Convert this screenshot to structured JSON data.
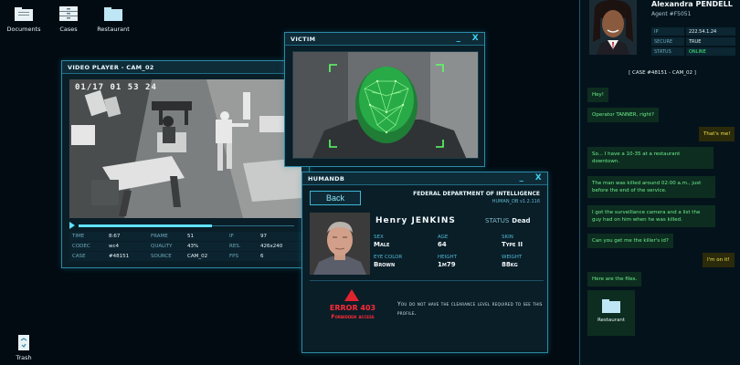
{
  "desktop": {
    "icons": [
      {
        "label": "Documents"
      },
      {
        "label": "Cases"
      },
      {
        "label": "Restaurant"
      },
      {
        "label": "Trash"
      }
    ]
  },
  "video_player": {
    "title": "VIDEO PLAYER - CAM_02",
    "timestamp": "01/17 01 53 24",
    "progress_fraction": 0.62,
    "meta": [
      {
        "k": "TIME",
        "v": "8:67"
      },
      {
        "k": "FRAME",
        "v": "51"
      },
      {
        "k": "IF",
        "v": "97"
      },
      {
        "k": "CODEC",
        "v": "wc4"
      },
      {
        "k": "QUALITY",
        "v": "43%"
      },
      {
        "k": "RES.",
        "v": "426x240"
      },
      {
        "k": "CASE",
        "v": "#48151"
      },
      {
        "k": "SOURCE",
        "v": "CAM_02"
      },
      {
        "k": "FPS",
        "v": "6"
      }
    ]
  },
  "victim": {
    "title": "VICTIM",
    "minimize": "_",
    "close": "X"
  },
  "humandb": {
    "title": "HUMANDB",
    "minimize": "_",
    "close": "X",
    "back_label": "Back",
    "agency": "FEDERAL DEPARTMENT OF INTELLIGENCE",
    "db_version": "HUMAN_DB     v1.2.116",
    "name": "Henry  JENKINS",
    "status_label": "STATUS",
    "status_value": "Dead",
    "fields": [
      {
        "label": "SEX",
        "value": "Male"
      },
      {
        "label": "AGE",
        "value": "64"
      },
      {
        "label": "SKIN",
        "value": "Type II"
      },
      {
        "label": "EYE COLOR",
        "value": "Brown"
      },
      {
        "label": "HEIGHT",
        "value": "1m79"
      },
      {
        "label": "WEIGHT",
        "value": "88kg"
      }
    ],
    "error_code": "ERROR 403",
    "error_sub": "Forbidden access",
    "error_msg": "You do not have the clearance level required to see this profile."
  },
  "agent": {
    "name": "Alexandra PENDELL",
    "id": "Agent #F5051",
    "info": [
      {
        "k": "IP",
        "v": "222.54.1.24"
      },
      {
        "k": "SECURE",
        "v": "TRUE"
      },
      {
        "k": "STATUS",
        "v": "ONLINE"
      }
    ]
  },
  "chat": {
    "case_header": "[ CASE #48151 - CAM_02 ]",
    "messages": [
      {
        "dir": "in",
        "text": "Hey!"
      },
      {
        "dir": "in",
        "text": "Operator TANNER, right?"
      },
      {
        "dir": "out",
        "text": "That's me!"
      },
      {
        "dir": "in",
        "text": "So... I have a 10-35 at a restaurant downtown."
      },
      {
        "dir": "in",
        "text": "The man was killed around 02:00 a.m., just before the end of the service."
      },
      {
        "dir": "in",
        "text": "I got the surveillance camera and a list the guy had on him when he was killed."
      },
      {
        "dir": "in",
        "text": "Can you get me the killer's id?"
      },
      {
        "dir": "out",
        "text": "I'm on it!"
      },
      {
        "dir": "in",
        "text": "Here are the files."
      }
    ],
    "attachment_label": "Restaurant"
  },
  "colors": {
    "accent": "#3fd0ee",
    "error": "#ff2a36",
    "chat_in": "#6ef08e",
    "chat_out": "#f2e24a",
    "online": "#41f07a"
  }
}
